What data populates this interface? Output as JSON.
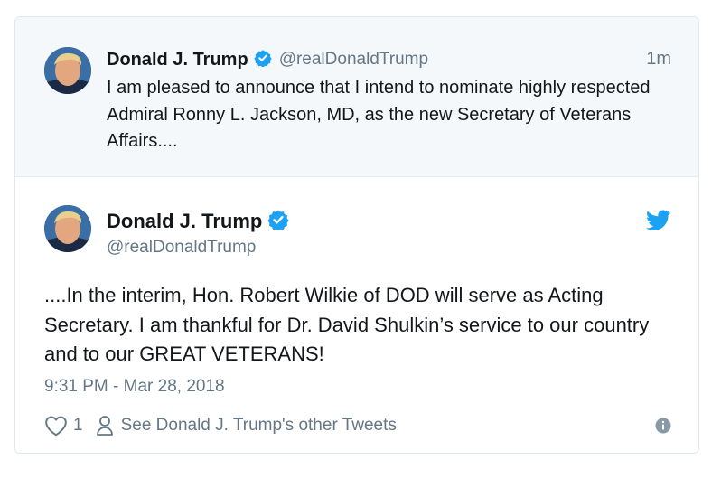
{
  "parent_tweet": {
    "author_name": "Donald J. Trump",
    "author_handle": "@realDonaldTrump",
    "time_ago": "1m",
    "text": "I am pleased to announce that I intend to nominate highly respected Admiral Ronny L. Jackson, MD, as the new Secretary of Veterans Affairs...."
  },
  "main_tweet": {
    "author_name": "Donald J. Trump",
    "author_handle": "@realDonaldTrump",
    "text": "....In the interim, Hon. Robert Wilkie of DOD will serve as Acting Secretary. I am thankful for Dr. David Shulkin’s service to our country and to our GREAT VETERANS!",
    "timestamp": "9:31 PM - Mar 28, 2018",
    "like_count": "1",
    "see_more_label": "See Donald J. Trump's other Tweets"
  },
  "icons": {
    "verified": "verified-badge-icon",
    "brand": "twitter-bird-icon",
    "like": "heart-icon",
    "profile": "person-icon",
    "info": "info-icon"
  },
  "colors": {
    "accent": "#1da1f2",
    "text": "#14171a",
    "muted": "#657786",
    "parent_bg": "#f5f8fa",
    "border": "#e1e8ed"
  }
}
